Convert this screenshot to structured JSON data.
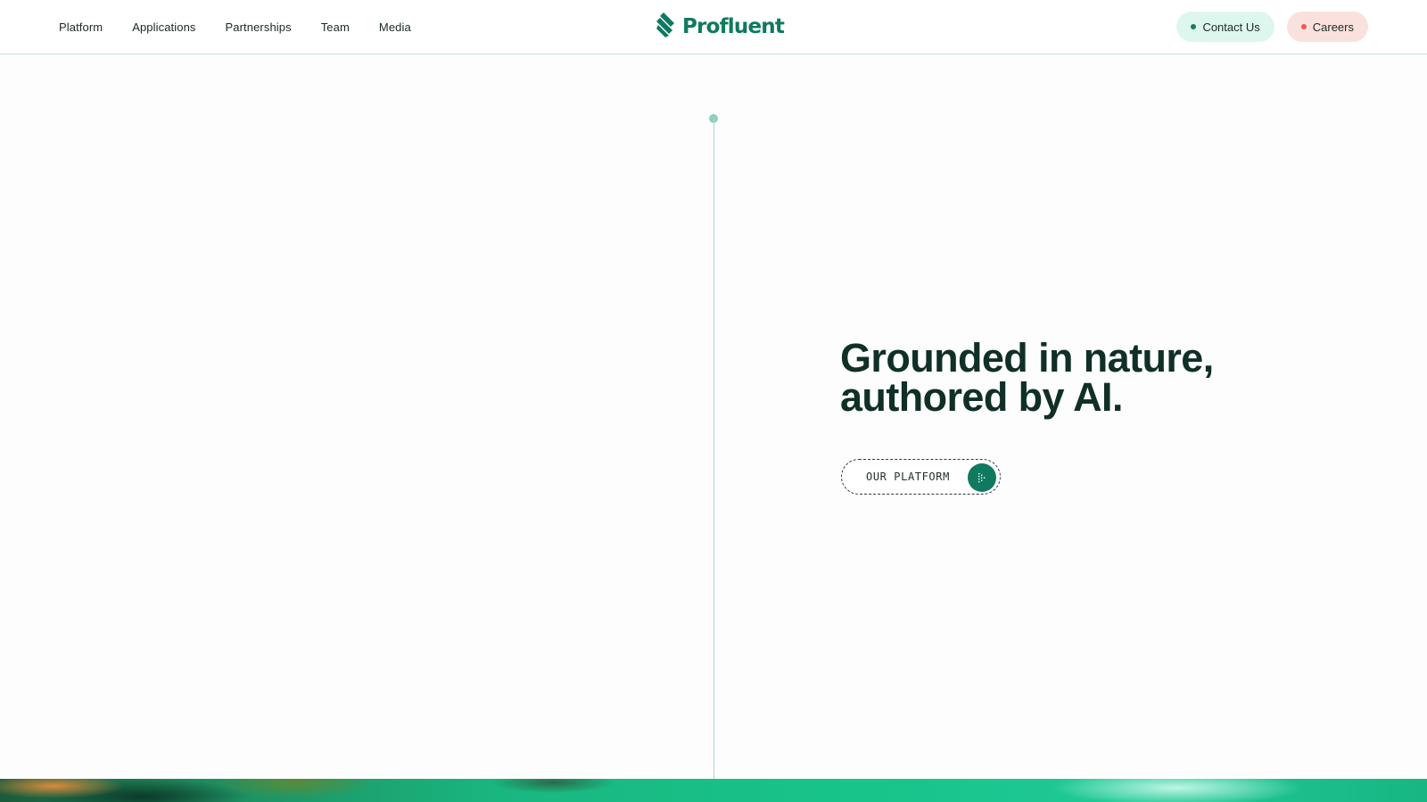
{
  "nav": {
    "items": [
      {
        "label": "Platform"
      },
      {
        "label": "Applications"
      },
      {
        "label": "Partnerships"
      },
      {
        "label": "Team"
      },
      {
        "label": "Media"
      }
    ]
  },
  "logo": {
    "text": "Profluent",
    "icon": "profluent-stripes-icon",
    "color": "#0f7a5f"
  },
  "actions": {
    "contact_label": "Contact Us",
    "careers_label": "Careers",
    "contact_bg": "#def7ee",
    "careers_bg": "#fbe1dd"
  },
  "hero": {
    "title_line1": "Grounded in nature,",
    "title_line2": "authored by AI.",
    "cta_label": "OUR PLATFORM",
    "cta_icon": "dotted-arrow-icon"
  },
  "colors": {
    "accent": "#0f7a5f",
    "text_dark": "#0f2f27",
    "divider": "#a9d7cc"
  }
}
